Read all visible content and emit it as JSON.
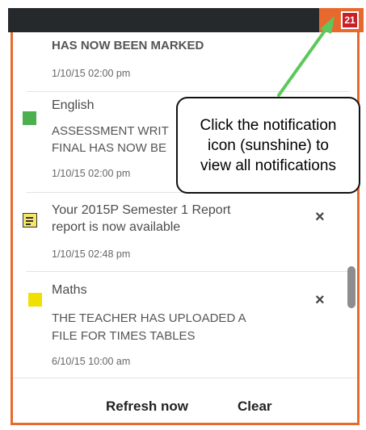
{
  "header": {
    "badge_count": "21",
    "notification_button_color": "#e8692e",
    "badge_color": "#c81e28"
  },
  "notifications": [
    {
      "title": "",
      "message": "HAS NOW BEEN MARKED",
      "time": "1/10/15 02:00 pm"
    },
    {
      "title": "English",
      "message_line1": "ASSESSMENT WRIT",
      "message_line2": "FINAL HAS NOW BE",
      "time": "1/10/15 02:00 pm",
      "marker_color": "#4caf50"
    },
    {
      "title_line1": "Your 2015P Semester 1 Report",
      "title_line2": "report is now available",
      "time": "1/10/15 02:48 pm",
      "icon": "report-icon",
      "dismiss": "×"
    },
    {
      "title": "Maths",
      "message_line1": "THE TEACHER HAS UPLOADED A",
      "message_line2": "FILE FOR TIMES TABLES",
      "time": "6/10/15 10:00 am",
      "marker_color": "#f0e000",
      "dismiss": "×"
    }
  ],
  "footer": {
    "refresh_label": "Refresh now",
    "clear_label": "Clear"
  },
  "callout": {
    "line1": "Click the notification",
    "line2": "icon (sunshine) to",
    "line3": "view all notifications",
    "arrow_color": "#5cc85c"
  }
}
